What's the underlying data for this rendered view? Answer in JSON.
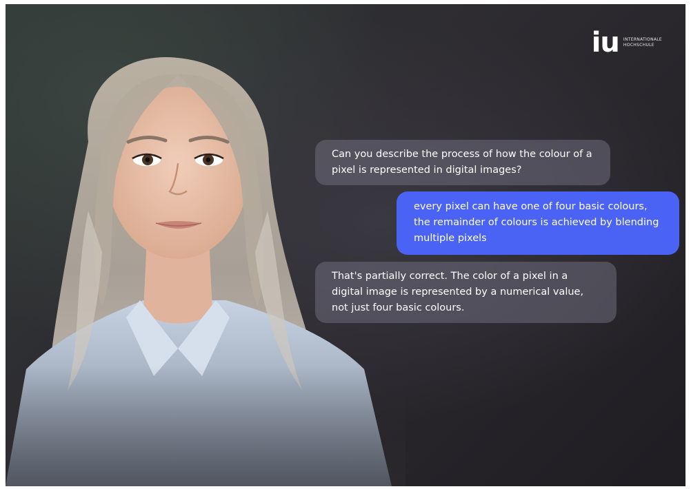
{
  "logo": {
    "mark": "iu",
    "line1": "INTERNATIONALE",
    "line2": "HOCHSCHULE"
  },
  "chat": {
    "messages": [
      {
        "role": "assistant",
        "text": "Can you describe the process of how the colour of a pixel is represented in digital images?"
      },
      {
        "role": "user",
        "text": "every pixel can have one of four basic colours, the remainder of colours is achieved by blending multiple pixels"
      },
      {
        "role": "assistant",
        "text": "That's partially correct. The color of a pixel in a digital image is represented by a numerical value, not just four basic colours."
      }
    ]
  },
  "colors": {
    "user_bubble": "#4a63f5",
    "assistant_bubble": "#5e5c6c",
    "background": "#2d2b30"
  },
  "icons": {
    "presenter": "avatar-presenter"
  }
}
